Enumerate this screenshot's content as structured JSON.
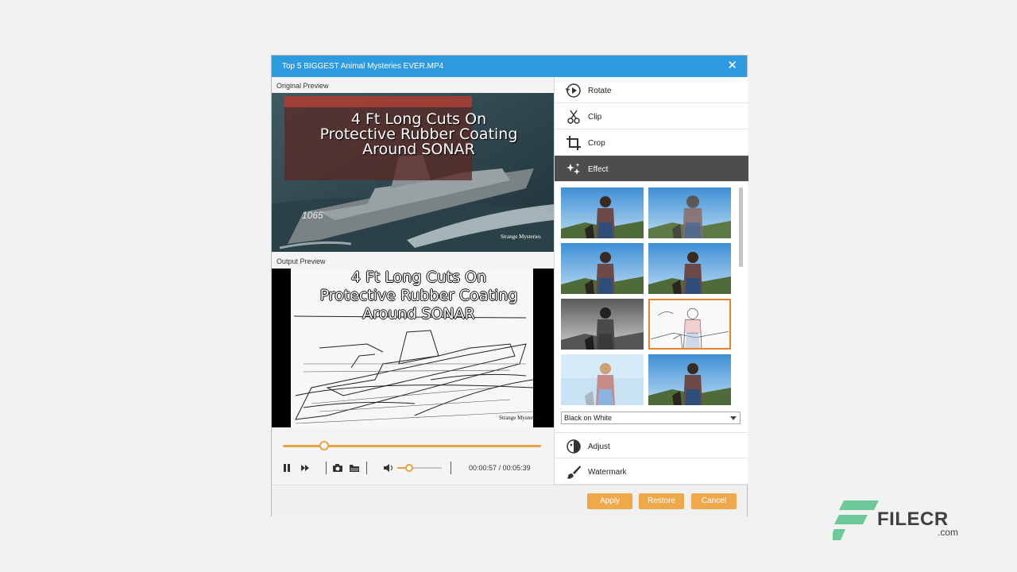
{
  "window": {
    "title": "Top 5 BIGGEST Animal Mysteries EVER.MP4",
    "close_glyph": "✕"
  },
  "preview": {
    "original_label": "Original Preview",
    "output_label": "Output Preview",
    "caption_lines": [
      "4 Ft Long Cuts On",
      "Protective Rubber Coating",
      "Around SONAR"
    ],
    "hull_number": "1065",
    "corner_logo": "Strange Mysteries"
  },
  "player": {
    "progress": 0.16,
    "volume": 0.25,
    "current_time": "00:00:57",
    "separator": "/",
    "total_time": "00:05:39",
    "icons": [
      "pause-icon",
      "next-frame-icon",
      "snapshot-icon",
      "folder-icon",
      "volume-icon"
    ]
  },
  "menu": {
    "rotate": "Rotate",
    "clip": "Clip",
    "crop": "Crop",
    "effect": "Effect",
    "adjust": "Adjust",
    "watermark": "Watermark"
  },
  "effects": {
    "selected_index": 5,
    "selected_value": "Black on White",
    "thumbnail_count": 8
  },
  "buttons": {
    "apply": "Apply",
    "restore": "Restore",
    "cancel": "Cancel"
  },
  "watermark": {
    "name": "FILECR",
    "domain": ".com"
  },
  "colors": {
    "title_bar": "#2e9be0",
    "accent": "#efa84a",
    "active_menu": "#4d4d4d",
    "selection_border": "#e9812f",
    "logo_green": "#6cc99a"
  }
}
